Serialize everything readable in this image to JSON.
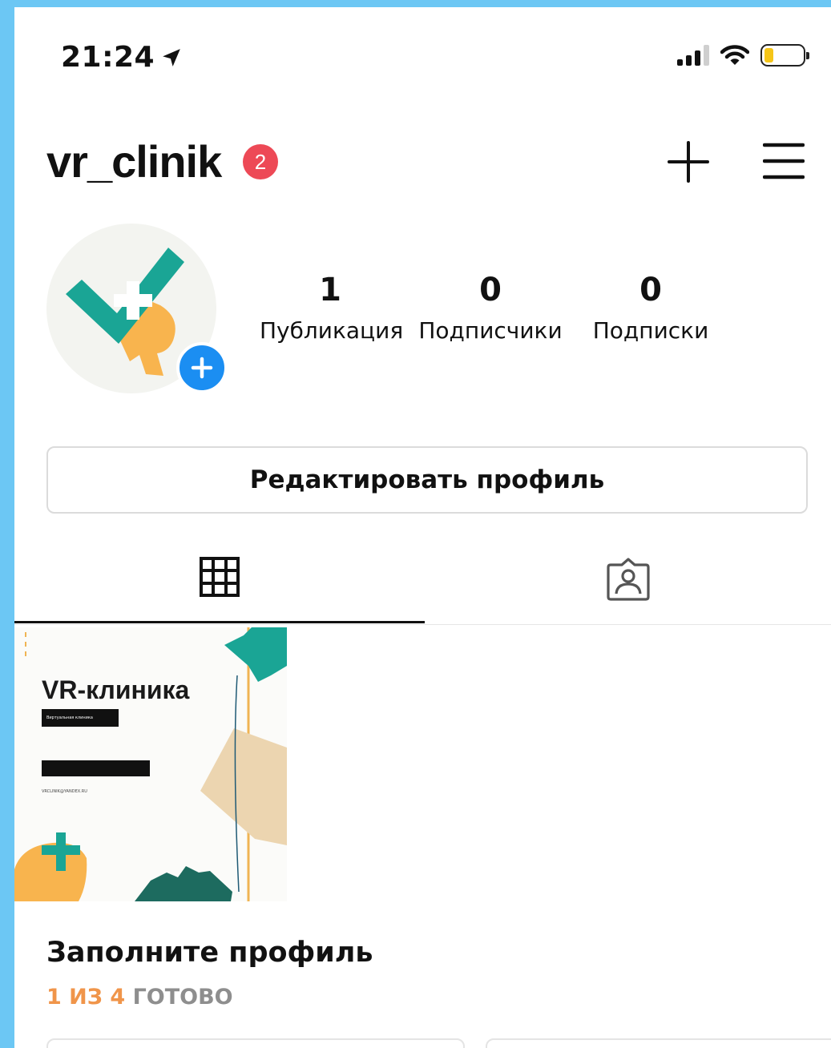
{
  "status_bar": {
    "time": "21:24",
    "battery_color": "#f5c518"
  },
  "header": {
    "username": "vr_clinik",
    "notifications": "2"
  },
  "stats": [
    {
      "value": "1",
      "label": "Публикация"
    },
    {
      "value": "0",
      "label": "Подписчики"
    },
    {
      "value": "0",
      "label": "Подписки"
    }
  ],
  "edit_profile_label": "Редактировать профиль",
  "tabs": [
    {
      "icon": "grid-icon",
      "active": true
    },
    {
      "icon": "tagged-person-icon",
      "active": false
    }
  ],
  "post": {
    "title": "VR-клиника",
    "subtitle": "Виртуальная клиника",
    "email": "VRCLINIK@YANDEX.RU"
  },
  "complete_profile": {
    "title": "Заполните профиль",
    "progress_count": "1 ИЗ 4",
    "progress_status": "ГОТОВО"
  },
  "colors": {
    "badge": "#ed4956",
    "add_button": "#1b8ef2",
    "teal": "#1aa595",
    "orange": "#f8b44e",
    "progress_accent": "#f0954a"
  }
}
